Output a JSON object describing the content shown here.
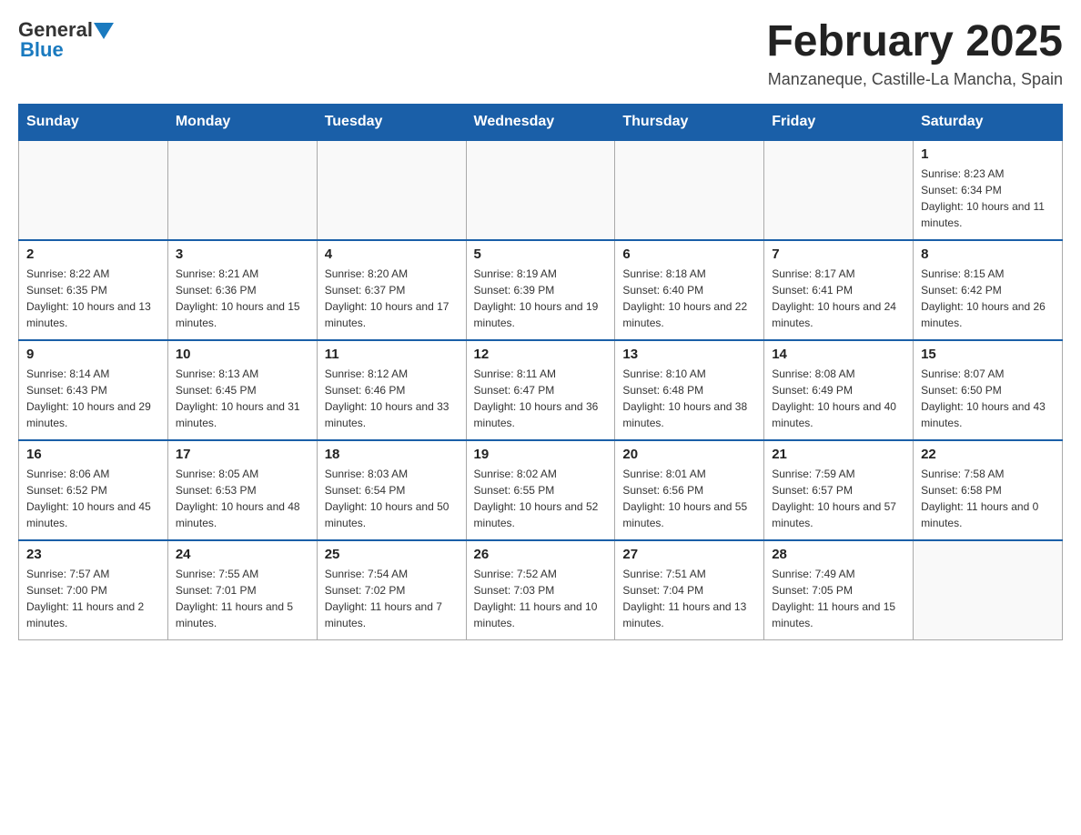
{
  "header": {
    "logo_general": "General",
    "logo_blue": "Blue",
    "title": "February 2025",
    "subtitle": "Manzaneque, Castille-La Mancha, Spain"
  },
  "days_of_week": [
    "Sunday",
    "Monday",
    "Tuesday",
    "Wednesday",
    "Thursday",
    "Friday",
    "Saturday"
  ],
  "weeks": [
    [
      {
        "day": "",
        "info": ""
      },
      {
        "day": "",
        "info": ""
      },
      {
        "day": "",
        "info": ""
      },
      {
        "day": "",
        "info": ""
      },
      {
        "day": "",
        "info": ""
      },
      {
        "day": "",
        "info": ""
      },
      {
        "day": "1",
        "info": "Sunrise: 8:23 AM\nSunset: 6:34 PM\nDaylight: 10 hours and 11 minutes."
      }
    ],
    [
      {
        "day": "2",
        "info": "Sunrise: 8:22 AM\nSunset: 6:35 PM\nDaylight: 10 hours and 13 minutes."
      },
      {
        "day": "3",
        "info": "Sunrise: 8:21 AM\nSunset: 6:36 PM\nDaylight: 10 hours and 15 minutes."
      },
      {
        "day": "4",
        "info": "Sunrise: 8:20 AM\nSunset: 6:37 PM\nDaylight: 10 hours and 17 minutes."
      },
      {
        "day": "5",
        "info": "Sunrise: 8:19 AM\nSunset: 6:39 PM\nDaylight: 10 hours and 19 minutes."
      },
      {
        "day": "6",
        "info": "Sunrise: 8:18 AM\nSunset: 6:40 PM\nDaylight: 10 hours and 22 minutes."
      },
      {
        "day": "7",
        "info": "Sunrise: 8:17 AM\nSunset: 6:41 PM\nDaylight: 10 hours and 24 minutes."
      },
      {
        "day": "8",
        "info": "Sunrise: 8:15 AM\nSunset: 6:42 PM\nDaylight: 10 hours and 26 minutes."
      }
    ],
    [
      {
        "day": "9",
        "info": "Sunrise: 8:14 AM\nSunset: 6:43 PM\nDaylight: 10 hours and 29 minutes."
      },
      {
        "day": "10",
        "info": "Sunrise: 8:13 AM\nSunset: 6:45 PM\nDaylight: 10 hours and 31 minutes."
      },
      {
        "day": "11",
        "info": "Sunrise: 8:12 AM\nSunset: 6:46 PM\nDaylight: 10 hours and 33 minutes."
      },
      {
        "day": "12",
        "info": "Sunrise: 8:11 AM\nSunset: 6:47 PM\nDaylight: 10 hours and 36 minutes."
      },
      {
        "day": "13",
        "info": "Sunrise: 8:10 AM\nSunset: 6:48 PM\nDaylight: 10 hours and 38 minutes."
      },
      {
        "day": "14",
        "info": "Sunrise: 8:08 AM\nSunset: 6:49 PM\nDaylight: 10 hours and 40 minutes."
      },
      {
        "day": "15",
        "info": "Sunrise: 8:07 AM\nSunset: 6:50 PM\nDaylight: 10 hours and 43 minutes."
      }
    ],
    [
      {
        "day": "16",
        "info": "Sunrise: 8:06 AM\nSunset: 6:52 PM\nDaylight: 10 hours and 45 minutes."
      },
      {
        "day": "17",
        "info": "Sunrise: 8:05 AM\nSunset: 6:53 PM\nDaylight: 10 hours and 48 minutes."
      },
      {
        "day": "18",
        "info": "Sunrise: 8:03 AM\nSunset: 6:54 PM\nDaylight: 10 hours and 50 minutes."
      },
      {
        "day": "19",
        "info": "Sunrise: 8:02 AM\nSunset: 6:55 PM\nDaylight: 10 hours and 52 minutes."
      },
      {
        "day": "20",
        "info": "Sunrise: 8:01 AM\nSunset: 6:56 PM\nDaylight: 10 hours and 55 minutes."
      },
      {
        "day": "21",
        "info": "Sunrise: 7:59 AM\nSunset: 6:57 PM\nDaylight: 10 hours and 57 minutes."
      },
      {
        "day": "22",
        "info": "Sunrise: 7:58 AM\nSunset: 6:58 PM\nDaylight: 11 hours and 0 minutes."
      }
    ],
    [
      {
        "day": "23",
        "info": "Sunrise: 7:57 AM\nSunset: 7:00 PM\nDaylight: 11 hours and 2 minutes."
      },
      {
        "day": "24",
        "info": "Sunrise: 7:55 AM\nSunset: 7:01 PM\nDaylight: 11 hours and 5 minutes."
      },
      {
        "day": "25",
        "info": "Sunrise: 7:54 AM\nSunset: 7:02 PM\nDaylight: 11 hours and 7 minutes."
      },
      {
        "day": "26",
        "info": "Sunrise: 7:52 AM\nSunset: 7:03 PM\nDaylight: 11 hours and 10 minutes."
      },
      {
        "day": "27",
        "info": "Sunrise: 7:51 AM\nSunset: 7:04 PM\nDaylight: 11 hours and 13 minutes."
      },
      {
        "day": "28",
        "info": "Sunrise: 7:49 AM\nSunset: 7:05 PM\nDaylight: 11 hours and 15 minutes."
      },
      {
        "day": "",
        "info": ""
      }
    ]
  ]
}
